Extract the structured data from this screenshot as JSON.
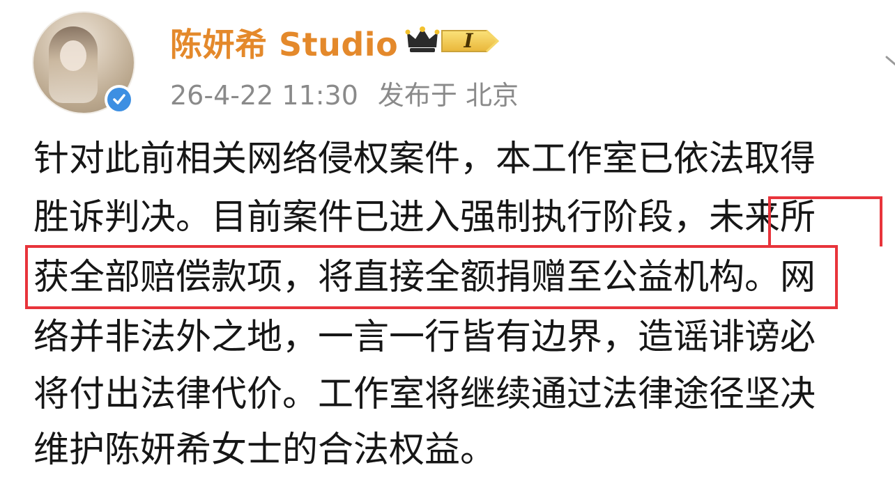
{
  "post": {
    "author": {
      "name": "陈妍希 Studio",
      "level": "I",
      "verified": true,
      "name_color": "#e4892b",
      "verified_color": "#3d8fe2"
    },
    "timestamp": "26-4-22 11:30",
    "location_prefix": "发布于",
    "location": "北京",
    "body_lines": [
      "针对此前相关网络侵权案件，本工作室已依法取得",
      "胜诉判决。目前案件已进入强制执行阶段，未来所",
      "获全部赔偿款项，将直接全额捐赠至公益机构。网",
      "络并非法外之地，一言一行皆有边界，造谣诽谤必",
      "将付出法律代价。工作室将继续通过法律途径坚决",
      "维护陈妍希女士的合法权益。"
    ],
    "highlight_color": "#e8343b"
  },
  "icons": {
    "avatar": "avatar-photo",
    "verified": "verified-check-icon",
    "crown": "crown-icon",
    "menu": "more-menu-icon"
  }
}
